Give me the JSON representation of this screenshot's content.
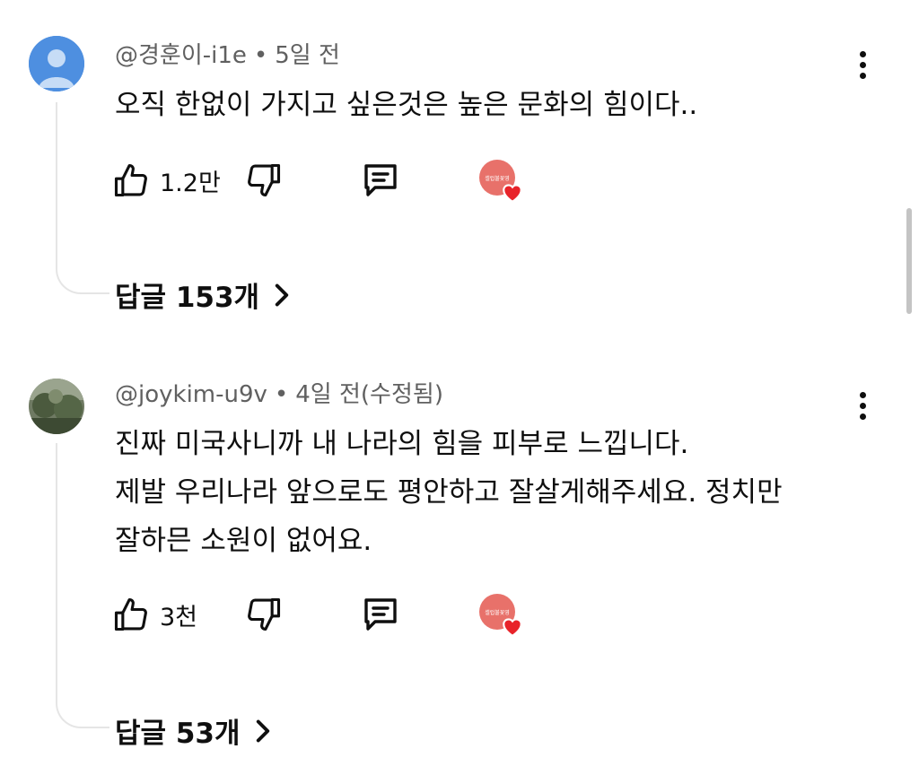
{
  "comments": [
    {
      "handle": "@경훈이-i1e",
      "time": "5일 전",
      "text": "오직 한없이 가지고 싶은것은 높은 문화의 힘이다..",
      "likes": "1.2만",
      "replies": "답글 153개",
      "creator_badge_text": "셀럽불꽃영"
    },
    {
      "handle": "@joykim-u9v",
      "time": "4일 전(수정됨)",
      "text": "진짜 미국사니까 내 나라의 힘을 피부로 느낍니다.\n제발 우리나라 앞으로도 평안하고 잘살게해주세요. 정치만\n잘하믄 소원이 없어요.",
      "likes": "3천",
      "replies": "답글 53개",
      "creator_badge_text": "셀럽불꽃영"
    }
  ],
  "icons": {
    "like": "thumbs-up-icon",
    "dislike": "thumbs-down-icon",
    "reply": "comment-icon",
    "more": "more-vert-icon",
    "chevron": "chevron-right-icon",
    "heart": "heart-icon"
  },
  "colors": {
    "heart": "#e8232a",
    "meta": "#606060",
    "default_avatar": "#4a90e2"
  }
}
